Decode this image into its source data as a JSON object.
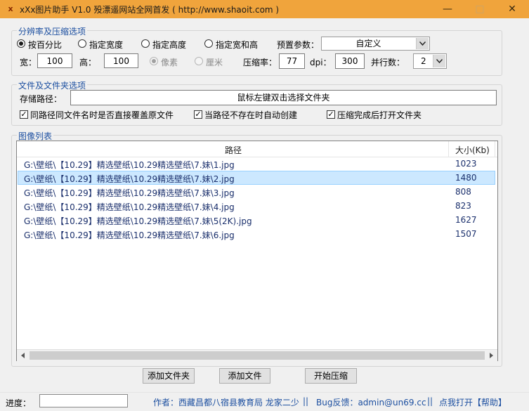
{
  "window": {
    "icon_glyph": "x",
    "title": "xXx图片助手 V1.0  殁漂遥网站全网首发 ( http://www.shaoit.com )",
    "min_glyph": "—",
    "max_glyph": "□",
    "close_glyph": "✕"
  },
  "resolution": {
    "title": "分辨率及压缩选项",
    "modes": [
      "按百分比",
      "指定宽度",
      "指定高度",
      "指定宽和高"
    ],
    "preset_label": "预置参数：",
    "preset_value": "自定义",
    "width_label": "宽：",
    "width_value": "100",
    "height_label": "高：",
    "height_value": "100",
    "unit_pixel": "像素",
    "unit_cm": "厘米",
    "compress_label": "压缩率：",
    "compress_value": "77",
    "dpi_label": "dpi：",
    "dpi_value": "300",
    "threads_label": "并行数：",
    "threads_value": "2"
  },
  "files": {
    "title": "文件及文件夹选项",
    "path_label": "存储路径：",
    "path_value": "鼠标左键双击选择文件夹",
    "options": [
      "同路径同文件名时是否直接覆盖原文件",
      "当路径不存在时自动创建",
      "压缩完成后打开文件夹"
    ]
  },
  "images": {
    "title": "图像列表",
    "col_path": "路径",
    "col_size": "大小(Kb)",
    "rows": [
      {
        "path": "G:\\壁纸\\【10.29】精选壁纸\\10.29精选壁纸\\7.妹\\1.jpg",
        "size": "1023"
      },
      {
        "path": "G:\\壁纸\\【10.29】精选壁纸\\10.29精选壁纸\\7.妹\\2.jpg",
        "size": "1480"
      },
      {
        "path": "G:\\壁纸\\【10.29】精选壁纸\\10.29精选壁纸\\7.妹\\3.jpg",
        "size": "808"
      },
      {
        "path": "G:\\壁纸\\【10.29】精选壁纸\\10.29精选壁纸\\7.妹\\4.jpg",
        "size": "823"
      },
      {
        "path": "G:\\壁纸\\【10.29】精选壁纸\\10.29精选壁纸\\7.妹\\5(2K).jpg",
        "size": "1627"
      },
      {
        "path": "G:\\壁纸\\【10.29】精选壁纸\\10.29精选壁纸\\7.妹\\6.jpg",
        "size": "1507"
      }
    ]
  },
  "actions": {
    "add_folder": "添加文件夹",
    "add_file": "添加文件",
    "start": "开始压缩"
  },
  "status": {
    "progress_label": "进度：",
    "author": "作者：西藏昌都八宿县教育局 龙家二少",
    "sep1": "||",
    "bug": "Bug反馈：admin@un69.cc",
    "sep2": "||",
    "help": "点我打开【帮助】"
  },
  "colors": {
    "titlebar": "#f0a43c",
    "accent_text": "#1c4fa0",
    "selection": "#cce8ff"
  }
}
